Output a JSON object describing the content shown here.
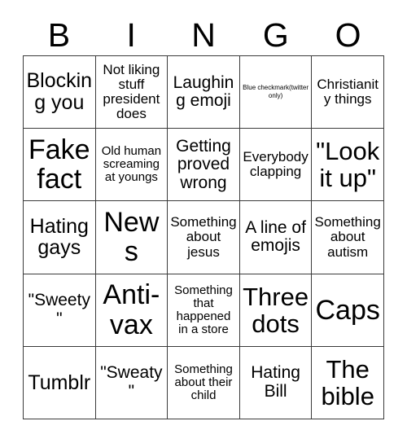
{
  "header": {
    "letters": [
      "B",
      "I",
      "N",
      "G",
      "O"
    ]
  },
  "grid": {
    "columns": 5,
    "rows": 5,
    "cells": [
      {
        "text": "Blocking you",
        "size": "lg"
      },
      {
        "text": "Not liking stuff president does",
        "size": "sm"
      },
      {
        "text": "Laughing emoji",
        "size": "md"
      },
      {
        "text": "Blue checkmark(twitter only)",
        "size": "xxs"
      },
      {
        "text": "Christianity things",
        "size": "sm"
      },
      {
        "text": "Fake fact",
        "size": "xxl"
      },
      {
        "text": "Old human screaming at youngs",
        "size": "xs"
      },
      {
        "text": "Getting proved wrong",
        "size": "md"
      },
      {
        "text": "Everybody clapping",
        "size": "sm"
      },
      {
        "text": "\"Look it up\"",
        "size": "xl"
      },
      {
        "text": "Hating gays",
        "size": "lg"
      },
      {
        "text": "News",
        "size": "xxl"
      },
      {
        "text": "Something about jesus",
        "size": "sm"
      },
      {
        "text": "A line of emojis",
        "size": "md"
      },
      {
        "text": "Something about autism",
        "size": "sm"
      },
      {
        "text": "\"Sweety\"",
        "size": "md"
      },
      {
        "text": "Anti-vax",
        "size": "xxl"
      },
      {
        "text": "Something that happened in a store",
        "size": "xs"
      },
      {
        "text": "Three dots",
        "size": "xl"
      },
      {
        "text": "Caps",
        "size": "xxl"
      },
      {
        "text": "Tumblr",
        "size": "lg"
      },
      {
        "text": "\"Sweaty\"",
        "size": "md"
      },
      {
        "text": "Something about their child",
        "size": "xs"
      },
      {
        "text": "Hating Bill",
        "size": "md"
      },
      {
        "text": "The bible",
        "size": "xl"
      }
    ]
  },
  "colors": {
    "background": "#ffffff",
    "text": "#000000",
    "border": "#3a3a3a"
  }
}
